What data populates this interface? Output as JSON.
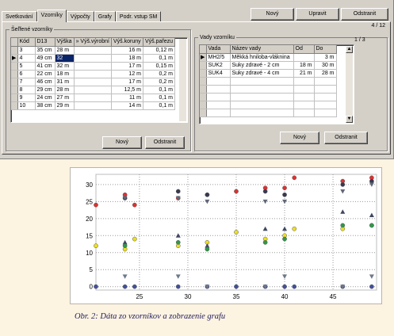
{
  "app": {
    "tabs": [
      {
        "label": "Svetkování",
        "active": false
      },
      {
        "label": "Vzorníky",
        "active": true
      },
      {
        "label": "Výpočty",
        "active": false
      },
      {
        "label": "Grafy",
        "active": false
      },
      {
        "label": "Podr. vstup SM",
        "active": false
      }
    ],
    "toolbar": {
      "new": "Nový",
      "edit": "Upravit",
      "delete": "Odstranit"
    },
    "record_counter": "4 / 12",
    "samples": {
      "title": "Šeľfené vzorníky",
      "columns": [
        "Kód",
        "D13",
        "Výška",
        "» Výš.výrobní",
        "Výš.koruny",
        "Výš.pařezu"
      ],
      "rows": [
        [
          "3",
          "35 cm",
          "28 m",
          "",
          "16 m",
          "0,12 m"
        ],
        [
          "4",
          "49 cm",
          "32",
          "",
          "18 m",
          "0,1 m"
        ],
        [
          "5",
          "41 cm",
          "32 m",
          "",
          "17 m",
          "0,15 m"
        ],
        [
          "6",
          "22 cm",
          "18 m",
          "",
          "12 m",
          "0,2 m"
        ],
        [
          "7",
          "46 cm",
          "31 m",
          "",
          "17 m",
          "0,2 m"
        ],
        [
          "8",
          "29 cm",
          "28 m",
          "",
          "12,5 m",
          "0,1 m"
        ],
        [
          "9",
          "24 cm",
          "27 m",
          "",
          "11 m",
          "0,1 m"
        ],
        [
          "10",
          "38 cm",
          "29 m",
          "",
          "14 m",
          "0,1 m"
        ]
      ],
      "selected_row": 1,
      "new": "Nový",
      "delete": "Odstranit"
    },
    "defects": {
      "title": "Vady vzorníku",
      "counter": "1 / 3",
      "columns": [
        "Vada",
        "Název vady",
        "Od",
        "Do"
      ],
      "rows": [
        [
          "MH2/5",
          "Měkká hniloba-vláknina",
          "",
          "3 m"
        ],
        [
          "SUK2",
          "Suky zdravé - 2 cm",
          "18 m",
          "30 m"
        ],
        [
          "SUK4",
          "Suky zdravé - 4 cm",
          "21 m",
          "28 m"
        ]
      ],
      "selected_row": 0,
      "new": "Nový",
      "delete": "Odstranit"
    }
  },
  "chart_data": {
    "type": "scatter",
    "x_ticks": [
      25,
      30,
      35,
      40,
      45
    ],
    "y_ticks": [
      0,
      5,
      10,
      15,
      20,
      25,
      30
    ],
    "xlim": [
      20.5,
      49.5
    ],
    "ylim": [
      -1,
      33
    ],
    "grid": true,
    "series": [
      {
        "color": "#e03030",
        "marker": "circle",
        "points": [
          [
            20.5,
            24
          ],
          [
            23.5,
            27
          ],
          [
            24.5,
            24
          ],
          [
            29,
            26
          ],
          [
            32,
            27
          ],
          [
            35,
            28
          ],
          [
            38,
            29
          ],
          [
            40,
            29
          ],
          [
            41,
            32
          ],
          [
            46,
            31
          ],
          [
            49,
            32
          ]
        ]
      },
      {
        "color": "#383850",
        "marker": "circle",
        "points": [
          [
            23.5,
            26
          ],
          [
            29,
            28
          ],
          [
            32,
            27
          ],
          [
            38,
            28
          ],
          [
            40,
            27
          ],
          [
            46,
            30
          ],
          [
            49,
            31
          ]
        ]
      },
      {
        "color": "#606878",
        "marker": "triangle-down",
        "points": [
          [
            23.5,
            26
          ],
          [
            29,
            26
          ],
          [
            32,
            25
          ],
          [
            38,
            25
          ],
          [
            40,
            25
          ],
          [
            46,
            28
          ],
          [
            49,
            30
          ]
        ]
      },
      {
        "color": "#ece020",
        "marker": "circle",
        "points": [
          [
            20.5,
            12
          ],
          [
            23.5,
            11
          ],
          [
            24.5,
            14
          ],
          [
            29,
            12
          ],
          [
            32,
            13
          ],
          [
            35,
            16
          ],
          [
            38,
            14
          ],
          [
            40,
            15
          ],
          [
            41,
            17
          ],
          [
            46,
            17
          ],
          [
            49,
            18
          ]
        ]
      },
      {
        "color": "#404860",
        "marker": "triangle-up",
        "points": [
          [
            23.5,
            13
          ],
          [
            29,
            15
          ],
          [
            32,
            12
          ],
          [
            38,
            17
          ],
          [
            40,
            17
          ],
          [
            46,
            22
          ],
          [
            49,
            21
          ]
        ]
      },
      {
        "color": "#2e9a48",
        "marker": "circle",
        "points": [
          [
            23.5,
            12
          ],
          [
            29,
            13
          ],
          [
            32,
            11
          ],
          [
            38,
            13
          ],
          [
            40,
            14
          ],
          [
            46,
            18
          ],
          [
            49,
            18
          ]
        ]
      },
      {
        "color": "#4050a0",
        "marker": "circle",
        "points": [
          [
            20.5,
            0
          ],
          [
            23.5,
            0
          ],
          [
            24.5,
            0
          ],
          [
            29,
            0
          ],
          [
            32,
            0
          ],
          [
            35,
            0
          ],
          [
            38,
            0
          ],
          [
            40,
            0
          ],
          [
            41,
            0
          ],
          [
            46,
            0
          ],
          [
            49,
            0
          ]
        ]
      },
      {
        "color": "#707888",
        "marker": "triangle-down",
        "points": [
          [
            23.5,
            3
          ],
          [
            29,
            3
          ],
          [
            32,
            0
          ],
          [
            38,
            0
          ],
          [
            40,
            3
          ],
          [
            46,
            0
          ],
          [
            49,
            3
          ]
        ]
      }
    ]
  },
  "caption": "Obr. 2: Dáta zo vzorníkov a zobrazenie grafu"
}
